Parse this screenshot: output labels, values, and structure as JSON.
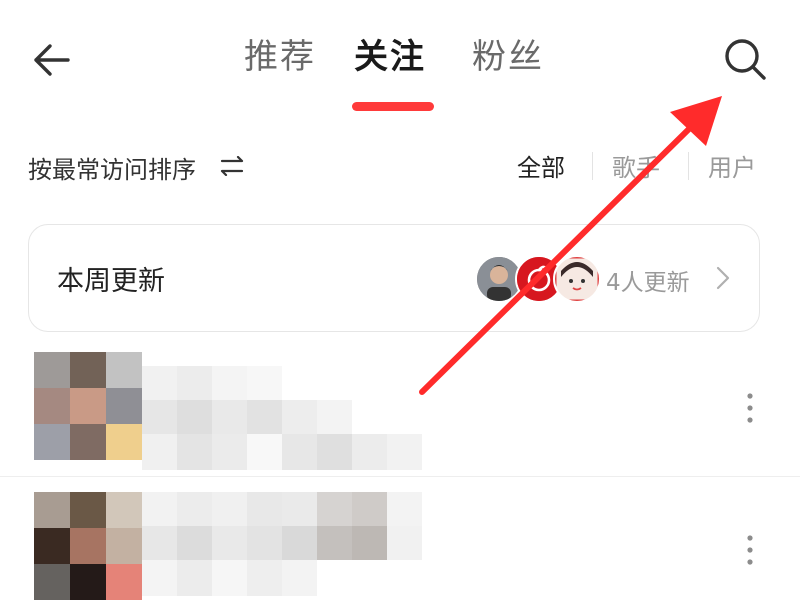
{
  "header": {
    "tabs": [
      {
        "label": "推荐",
        "active": false
      },
      {
        "label": "关注",
        "active": true
      },
      {
        "label": "粉丝",
        "active": false
      }
    ],
    "back_icon": "back-arrow-icon",
    "search_icon": "search-icon",
    "accent_color": "#ff3a3a"
  },
  "sort_bar": {
    "sort_label": "按最常访问排序",
    "sort_icon": "sort-toggle-icon",
    "filters": [
      {
        "label": "全部",
        "active": true
      },
      {
        "label": "歌手",
        "active": false
      },
      {
        "label": "用户",
        "active": false
      }
    ]
  },
  "weekly_update": {
    "title": "本周更新",
    "count_label": "4人更新",
    "chevron_icon": "chevron-right-icon"
  },
  "list": {
    "items": [
      {
        "more_icon": "more-vertical-icon"
      },
      {
        "more_icon": "more-vertical-icon"
      }
    ]
  },
  "annotation": {
    "arrow_color": "#ff2b2b"
  }
}
